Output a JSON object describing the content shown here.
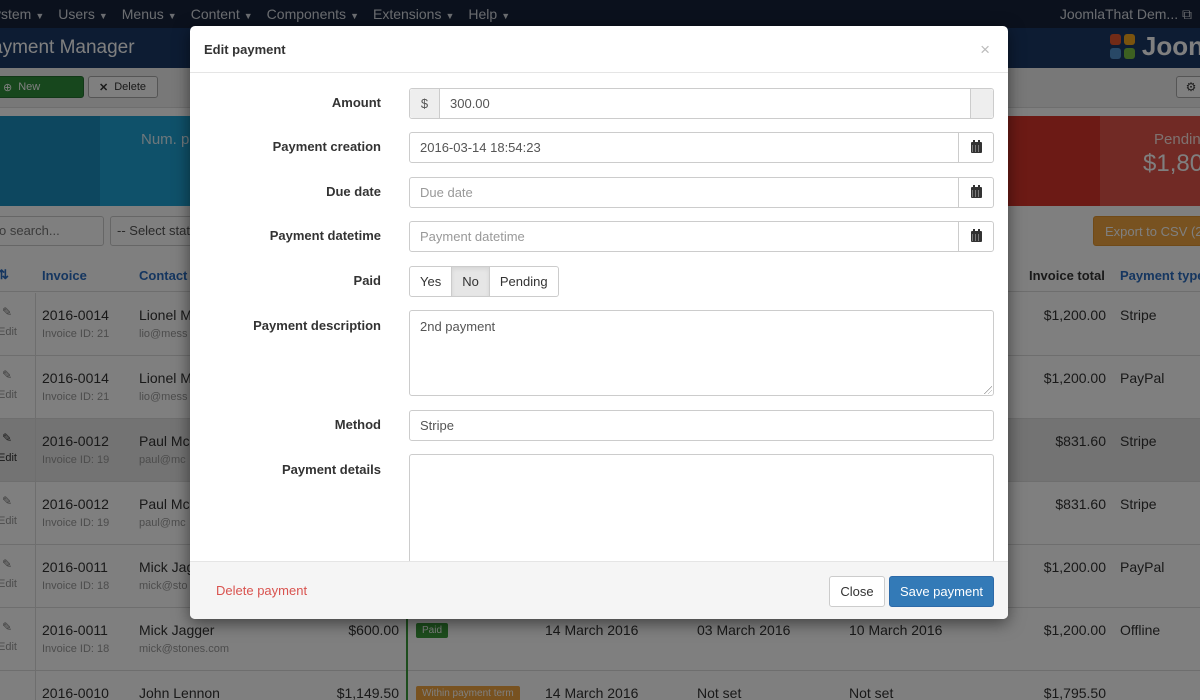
{
  "topbar": {
    "menu": [
      {
        "label": "ystem"
      },
      {
        "label": "Users"
      },
      {
        "label": "Menus"
      },
      {
        "label": "Content"
      },
      {
        "label": "Components"
      },
      {
        "label": "Extensions"
      },
      {
        "label": "Help"
      }
    ],
    "site_name": "JoomlaThat Dem..."
  },
  "header": {
    "title": "ayment Manager",
    "logo_text": "Joon"
  },
  "toolbar": {
    "new_label": "New",
    "delete_label": "Delete"
  },
  "stats": {
    "num_label": "Num. p",
    "pending_label": "Pendin",
    "pending_value": "$1,80"
  },
  "filters": {
    "search_placeholder": "o search...",
    "status_select": "-- Select stat",
    "export_label": "Export to CSV (2"
  },
  "table": {
    "headers": {
      "invoice": "Invoice",
      "contact": "Contact",
      "invoice_total": "Invoice total",
      "payment_type": "Payment type"
    },
    "edit_label": "Edit",
    "rows": [
      {
        "invoice": "2016-0014",
        "invoice_id": "Invoice ID: 21",
        "contact": "Lionel M",
        "email": "lio@mess",
        "total": "$1,200.00",
        "type": "Stripe",
        "highlight": false
      },
      {
        "invoice": "2016-0014",
        "invoice_id": "Invoice ID: 21",
        "contact": "Lionel M",
        "email": "lio@mess",
        "total": "$1,200.00",
        "type": "PayPal",
        "highlight": false
      },
      {
        "invoice": "2016-0012",
        "invoice_id": "Invoice ID: 19",
        "contact": "Paul Mc",
        "email": "paul@mc",
        "total": "$831.60",
        "type": "Stripe",
        "highlight": true
      },
      {
        "invoice": "2016-0012",
        "invoice_id": "Invoice ID: 19",
        "contact": "Paul Mc",
        "email": "paul@mc",
        "total": "$831.60",
        "type": "Stripe",
        "highlight": false
      },
      {
        "invoice": "2016-0011",
        "invoice_id": "Invoice ID: 18",
        "contact": "Mick Jag",
        "email": "mick@sto",
        "total": "$1,200.00",
        "type": "PayPal",
        "highlight": false
      },
      {
        "invoice": "2016-0011",
        "invoice_id": "Invoice ID: 18",
        "contact": "Mick Jagger",
        "email": "mick@stones.com",
        "amount": "$600.00",
        "status": "Paid",
        "date1": "14 March 2016",
        "date2": "03 March 2016",
        "date3": "10 March 2016",
        "total": "$1,200.00",
        "type": "Offline",
        "highlight": false
      },
      {
        "invoice": "2016-0010",
        "invoice_id": "",
        "contact": "John Lennon",
        "email": "",
        "amount": "$1,149.50",
        "status": "Within payment term",
        "date1": "14 March 2016",
        "date2": "Not set",
        "date3": "Not set",
        "total": "$1,795.50",
        "type": "",
        "highlight": false
      }
    ]
  },
  "modal": {
    "title": "Edit payment",
    "close_glyph": "×",
    "fields": {
      "amount": {
        "label": "Amount",
        "currency": "$",
        "value": "300.00"
      },
      "creation": {
        "label": "Payment creation",
        "value": "2016-03-14 18:54:23"
      },
      "due_date": {
        "label": "Due date",
        "placeholder": "Due date"
      },
      "datetime": {
        "label": "Payment datetime",
        "placeholder": "Payment datetime"
      },
      "paid": {
        "label": "Paid",
        "options": [
          "Yes",
          "No",
          "Pending"
        ],
        "selected": "No"
      },
      "description": {
        "label": "Payment description",
        "value": "2nd payment"
      },
      "method": {
        "label": "Method",
        "value": "Stripe"
      },
      "details": {
        "label": "Payment details",
        "value": ""
      }
    },
    "footer": {
      "delete_label": "Delete payment",
      "close_label": "Close",
      "save_label": "Save payment"
    }
  },
  "colors": {
    "topbar": "#17233a",
    "header": "#1a3867",
    "primary": "#337ab7",
    "danger": "#d9534f",
    "success": "#3a9b3a",
    "warning": "#f0a540"
  }
}
